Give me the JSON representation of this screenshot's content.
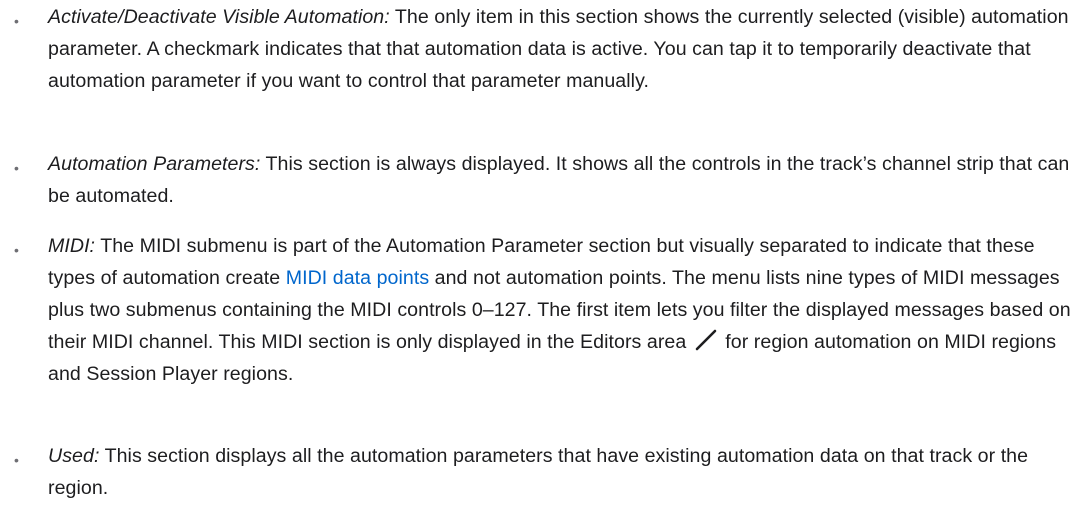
{
  "bullets": [
    {
      "term": "Activate/Deactivate Visible Automation:",
      "text": " The only item in this section shows the currently selected (visible) automation parameter. A checkmark indicates that that automation data is active. You can tap it to temporarily deactivate that automation parameter if you want to control that parameter manually."
    },
    {
      "term": "Automation Parameters:",
      "text": " This section is always displayed. It shows all the controls in the track’s channel strip that can be automated."
    },
    {
      "term": "MIDI:",
      "text_before_link": " The MIDI submenu is part of the Automation Parameter section but visually separated to indicate that these types of automation create ",
      "link": "MIDI data points",
      "text_after_link": " and not automation points. The menu lists nine types of MIDI messages plus two submenus containing the MIDI controls 0–127. The first item lets you filter the displayed messages based on their MIDI channel. This MIDI section is only displayed in the Editors area ",
      "icon": "pencil-icon",
      "text_end": " for region automation on MIDI regions and Session Player regions."
    },
    {
      "term": "Used:",
      "text": " This section displays all the automation parameters that have existing automation data on that track or the region."
    }
  ],
  "colors": {
    "text": "#1d1d1f",
    "link": "#0066cc",
    "bullet": "#6e6e73",
    "icon": "#1d1d1f"
  }
}
